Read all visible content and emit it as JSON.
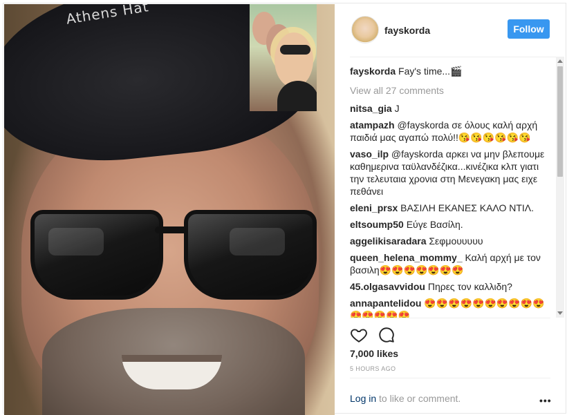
{
  "post": {
    "author": "fayskorda",
    "follow_label": "Follow",
    "cap_text": "Athens Hat",
    "caption": "Fay's time...🎬",
    "view_all": "View all 27 comments",
    "comments": [
      {
        "user": "nitsa_gia",
        "text": "J"
      },
      {
        "user": "atampazh",
        "text": "@fayskorda σε όλους καλή αρχή παιδιά μας αγαπώ πολύ!!😘😘😘😘😘😘"
      },
      {
        "user": "vaso_ilp",
        "text": "@fayskorda αρκει να μην βλεπουμε καθημερινα ταϋλανδέζικα...κινέζικα κλπ γιατι την τελευταια χρονια στη Μενεγακη μας ειχε πεθάνει"
      },
      {
        "user": "eleni_prsx",
        "text": "ΒΑΣΙΛΗ ΕΚΑΝΕΣ ΚΑΛΟ ΝΤΙΛ."
      },
      {
        "user": "eltsoump50",
        "text": "Εύγε Βασίλη."
      },
      {
        "user": "aggelikisaradara",
        "text": "Σεφμουυυυυ"
      },
      {
        "user": "queen_helena_mommy_",
        "text": "Καλή αρχή με τον βασιλη😍😍😍😍😍😍😍"
      },
      {
        "user": "45.olgasavvidou",
        "text": "Πηρες τον καλλιδη?"
      },
      {
        "user": "annapantelidou",
        "text": "😍😍😍😍😍😍😍😍😍😍😍😍😍😍😍"
      }
    ],
    "likes": "7,000 likes",
    "time": "5 HOURS AGO",
    "login_link": "Log in",
    "login_rest": " to like or comment.",
    "more": "•••"
  },
  "icons": [
    "heart-icon",
    "comment-icon",
    "more-options-icon"
  ],
  "colors": {
    "accent": "#3897f0",
    "link": "#003569",
    "muted": "#999999"
  }
}
